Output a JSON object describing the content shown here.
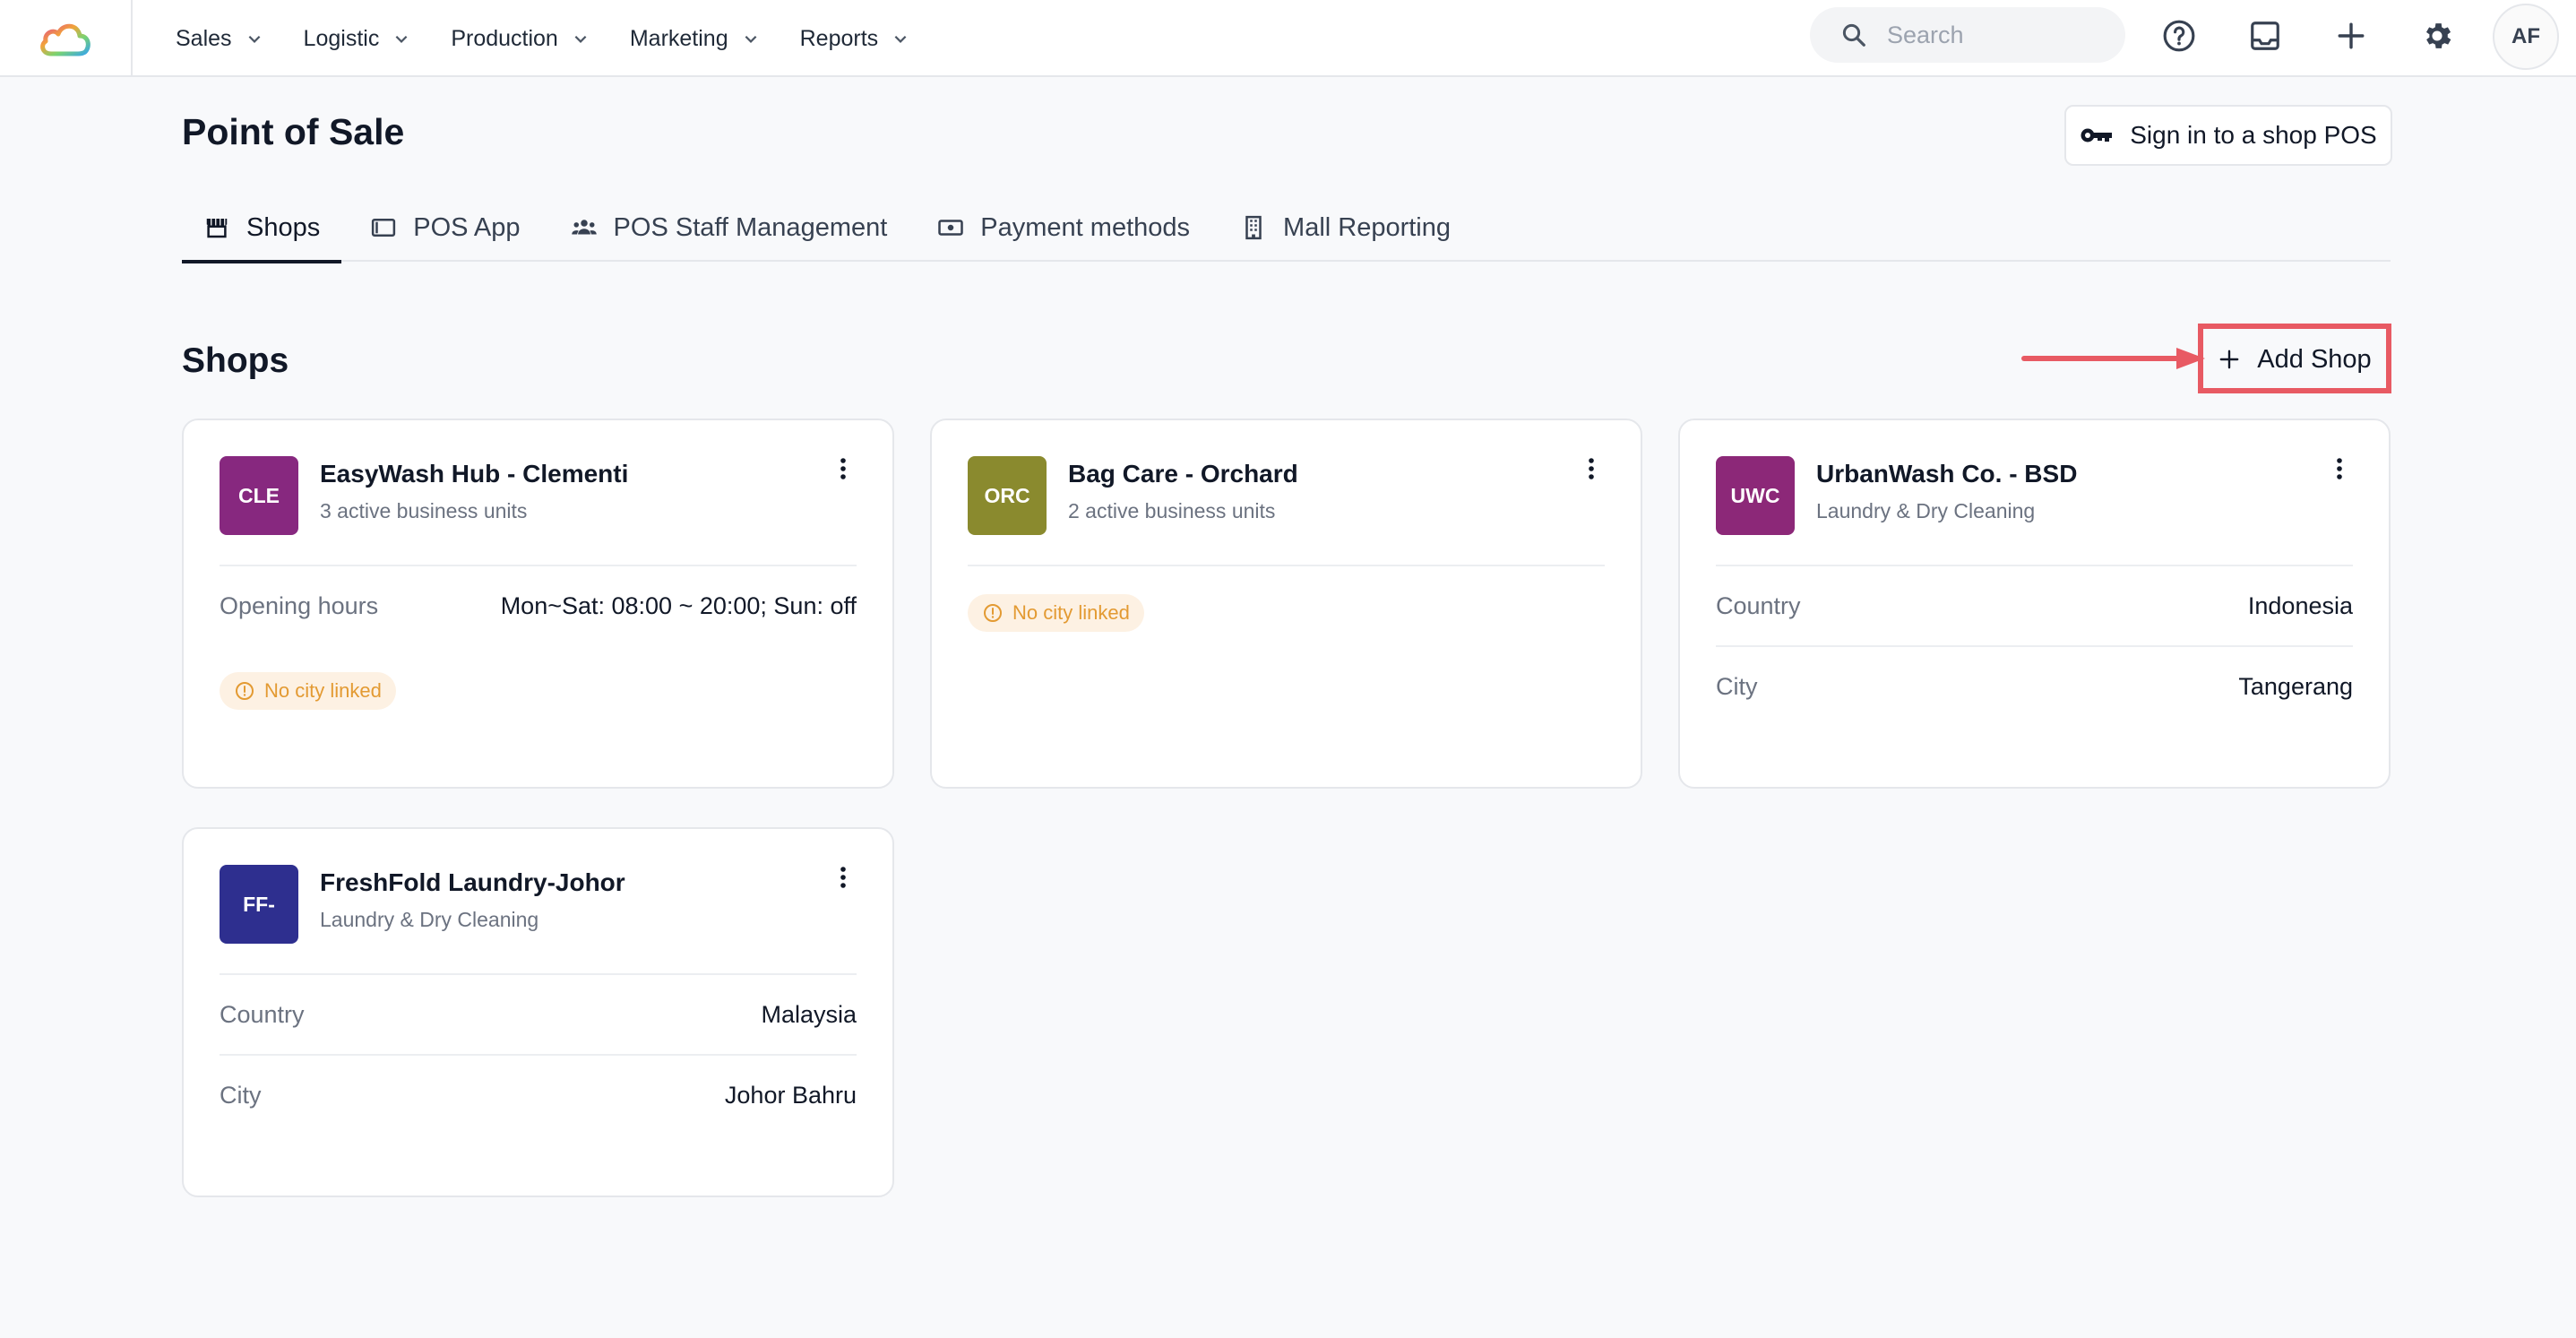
{
  "nav": {
    "items": [
      {
        "label": "Sales"
      },
      {
        "label": "Logistic"
      },
      {
        "label": "Production"
      },
      {
        "label": "Marketing"
      },
      {
        "label": "Reports"
      }
    ],
    "search_placeholder": "Search",
    "avatar_initials": "AF",
    "icons": [
      "help-icon",
      "inbox-icon",
      "plus-icon",
      "gear-icon"
    ]
  },
  "header": {
    "title": "Point of Sale",
    "signin_label": "Sign in to a shop POS"
  },
  "tabs": [
    {
      "label": "Shops",
      "icon": "storefront-icon",
      "active": true
    },
    {
      "label": "POS App",
      "icon": "tablet-icon"
    },
    {
      "label": "POS Staff Management",
      "icon": "people-icon"
    },
    {
      "label": "Payment methods",
      "icon": "cash-icon"
    },
    {
      "label": "Mall Reporting",
      "icon": "building-icon"
    }
  ],
  "section": {
    "title": "Shops",
    "add_label": "Add Shop",
    "annotation_color": "#e85a63"
  },
  "shops": [
    {
      "initials": "CLE",
      "name": "EasyWash Hub - Clementi",
      "subtitle": "3 active business units",
      "color": "#87287f",
      "hours_label": "Opening hours",
      "hours_value": "Mon~Sat: 08:00 ~ 20:00; Sun: off",
      "badge": "No city linked"
    },
    {
      "initials": "ORC",
      "name": "Bag Care - Orchard",
      "subtitle": "2 active business units",
      "color": "#8a8a2e",
      "badge": "No city linked"
    },
    {
      "initials": "UWC",
      "name": "UrbanWash Co. - BSD",
      "subtitle": "Laundry & Dry Cleaning",
      "color": "#8c2878",
      "country_label": "Country",
      "country": "Indonesia",
      "city_label": "City",
      "city": "Tangerang"
    },
    {
      "initials": "FF-",
      "name": "FreshFold Laundry-Johor",
      "subtitle": "Laundry & Dry Cleaning",
      "color": "#2e2f8f",
      "country_label": "Country",
      "country": "Malaysia",
      "city_label": "City",
      "city": "Johor Bahru"
    }
  ]
}
